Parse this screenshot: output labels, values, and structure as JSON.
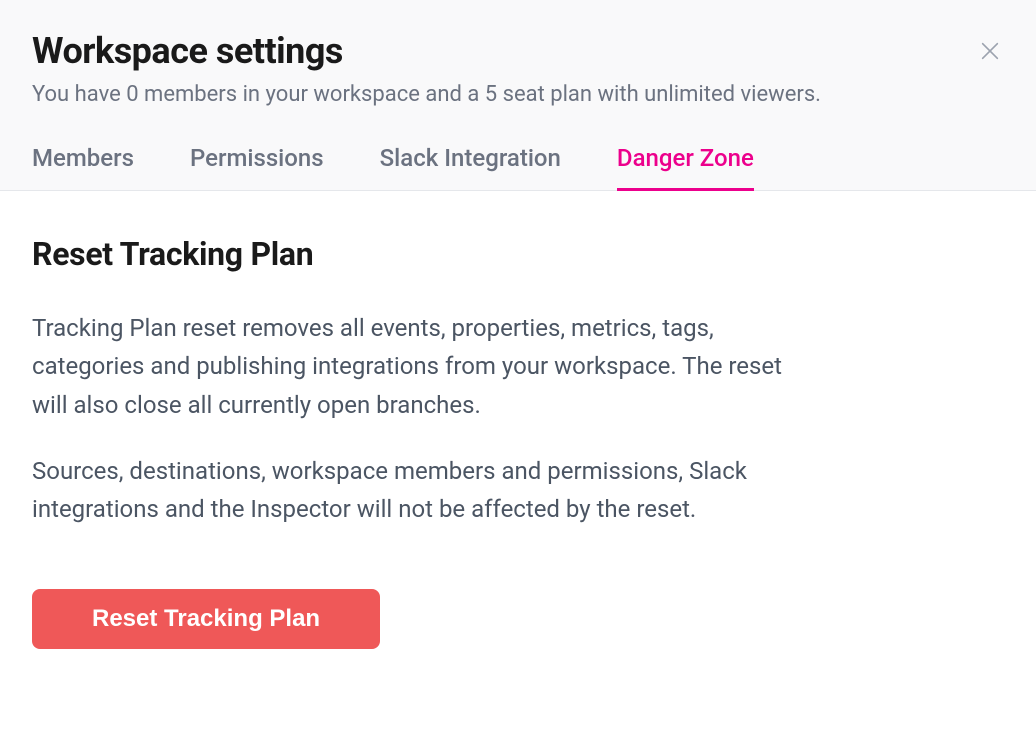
{
  "header": {
    "title": "Workspace settings",
    "subtitle": "You have 0 members in your workspace and a 5 seat plan with unlimited viewers."
  },
  "tabs": [
    {
      "label": "Members",
      "active": false
    },
    {
      "label": "Permissions",
      "active": false
    },
    {
      "label": "Slack Integration",
      "active": false
    },
    {
      "label": "Danger Zone",
      "active": true
    }
  ],
  "dangerZone": {
    "sectionTitle": "Reset Tracking Plan",
    "paragraph1": "Tracking Plan reset removes all events, properties, metrics, tags, categories and publishing integrations from your workspace. The reset will also close all currently open branches.",
    "paragraph2": "Sources, destinations, workspace members and permissions, Slack integrations and the Inspector will not be affected by the reset.",
    "resetButtonLabel": "Reset Tracking Plan"
  },
  "colors": {
    "accent": "#ec008c",
    "danger": "#ef5858"
  }
}
